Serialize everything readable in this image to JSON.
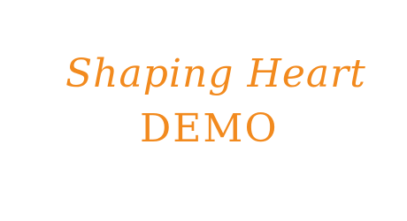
{
  "font_preview": {
    "line1": "Shaping Heart",
    "line2": "DEMO",
    "text_color": "#F28A1E",
    "background_color": "#FFFFFF"
  }
}
